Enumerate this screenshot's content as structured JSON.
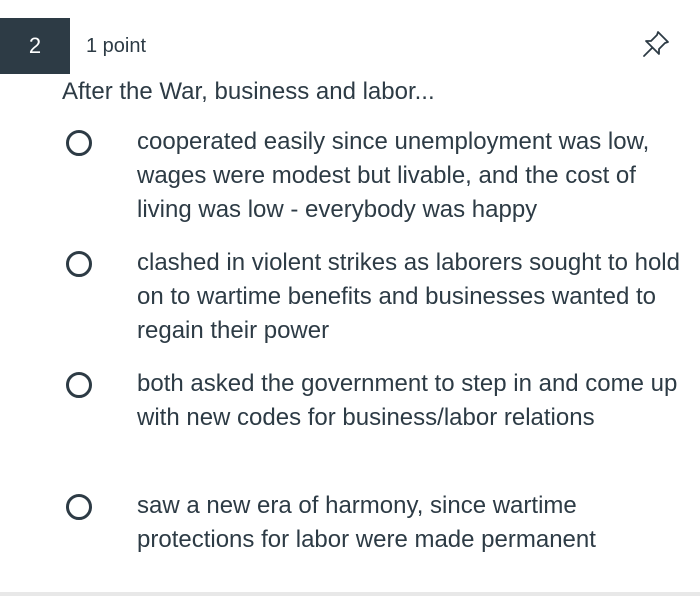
{
  "question": {
    "number": "2",
    "points": "1 point",
    "prompt": "After the War, business and labor..."
  },
  "options": [
    {
      "text": "cooperated easily since unemployment was low, wages were modest but livable, and the cost of living was low - everybody was happy"
    },
    {
      "text": "clashed in violent strikes as laborers sought to hold on to wartime benefits and businesses wanted to regain their power"
    },
    {
      "text": "both asked the government to step in and come up with new codes for business/labor relations"
    },
    {
      "text": "saw a new era of harmony, since wartime protections for labor were made permanent"
    }
  ],
  "icons": {
    "pin": "pin-icon",
    "radio": "radio-unselected-icon"
  },
  "colors": {
    "text": "#2d3b45",
    "badge_bg": "#2d3b45",
    "badge_text": "#ffffff",
    "background": "#ffffff"
  }
}
